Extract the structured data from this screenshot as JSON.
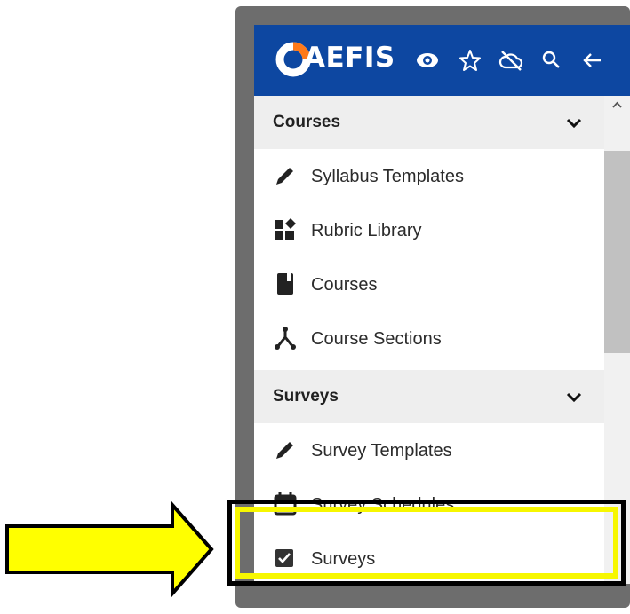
{
  "app": {
    "brand": "AEFIS",
    "header_icons": [
      "eye-icon",
      "star-icon",
      "cloud-off-icon",
      "search-icon",
      "back-arrow-icon"
    ]
  },
  "sections": [
    {
      "title": "Courses",
      "expanded": true,
      "items": [
        {
          "label": "Syllabus Templates",
          "icon": "pencil-icon"
        },
        {
          "label": "Rubric Library",
          "icon": "widgets-icon"
        },
        {
          "label": "Courses",
          "icon": "book-icon"
        },
        {
          "label": "Course Sections",
          "icon": "fork-icon"
        }
      ]
    },
    {
      "title": "Surveys",
      "expanded": true,
      "items": [
        {
          "label": "Survey Templates",
          "icon": "pencil-icon"
        },
        {
          "label": "Survey Schedules",
          "icon": "calendar-icon"
        },
        {
          "label": "Surveys",
          "icon": "checkbox-icon"
        }
      ]
    }
  ],
  "colors": {
    "header": "#0d47a1",
    "section_bg": "#eeeeee",
    "highlight_yellow": "#f7f700",
    "frame": "#6d6d6d"
  }
}
